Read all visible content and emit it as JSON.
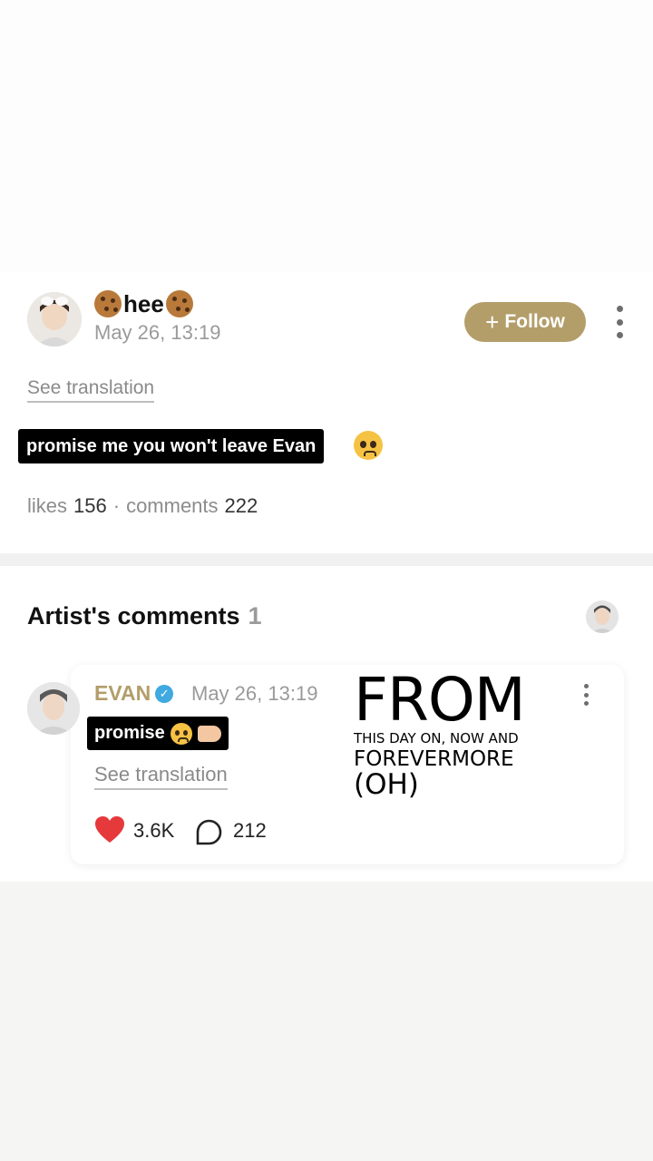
{
  "post": {
    "author": "hee",
    "date": "May 26, 13:19",
    "follow_label": "Follow",
    "translate_label": "See translation",
    "caption": "promise me you won't leave Evan",
    "stats": {
      "likes_label": "likes",
      "likes_value": "156",
      "separator": "·",
      "comments_label": "comments",
      "comments_value": "222"
    }
  },
  "artist_comments": {
    "title": "Artist's comments",
    "count": "1",
    "comment": {
      "author": "EVAN",
      "date": "May 26, 13:19",
      "text": "promise",
      "translate_label": "See translation",
      "likes": "3.6K",
      "replies": "212"
    }
  },
  "lyric_overlay": {
    "line1": "FROM",
    "line2": "THIS DAY ON, NOW AND",
    "line3": "FOREVERMORE",
    "line4": "(OH)"
  },
  "colors": {
    "accent_gold": "#b39e6a",
    "verified_blue": "#3fa9e0",
    "heart_red": "#e5393b"
  },
  "icons": [
    "cookie-emoji",
    "plus-icon",
    "more-vert-icon",
    "pleading-face-emoji",
    "verified-icon",
    "backhand-index-emoji",
    "heart-icon",
    "comment-bubble-icon"
  ]
}
